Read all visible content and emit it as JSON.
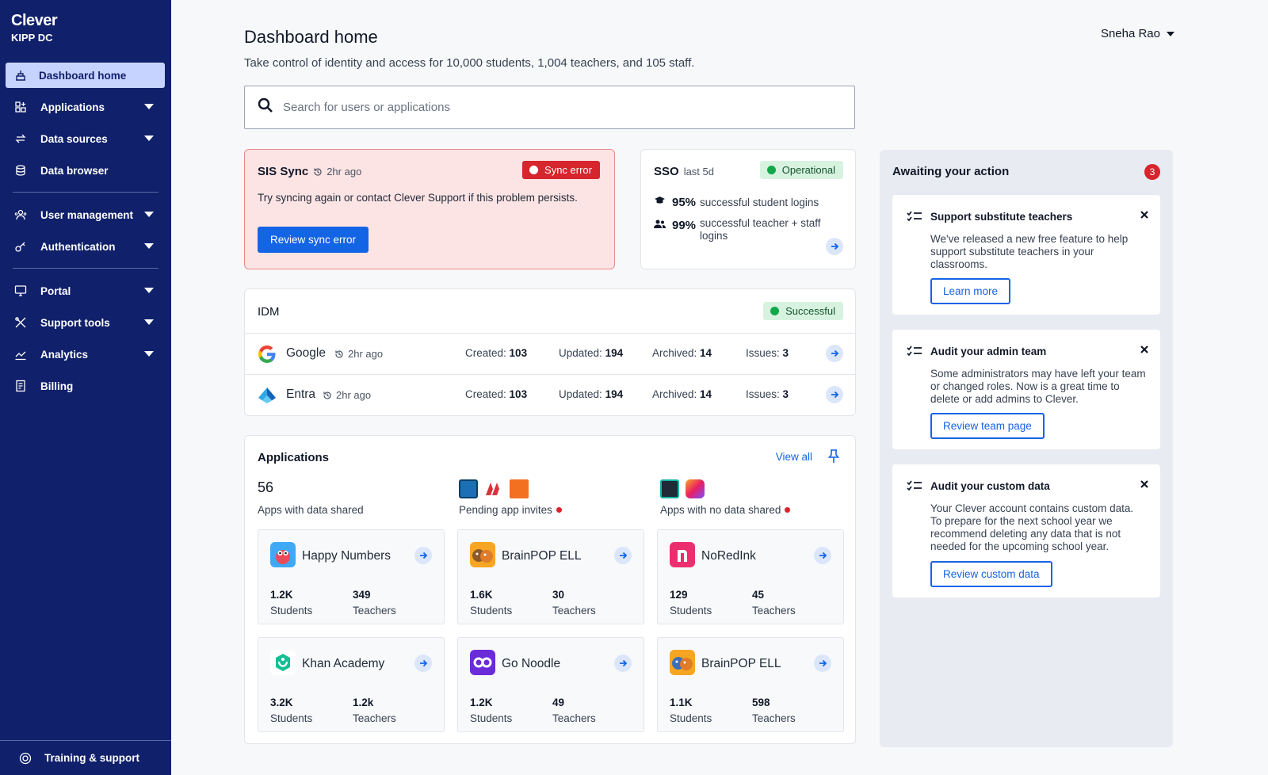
{
  "sidebar": {
    "logo": "Clever",
    "district": "KIPP DC",
    "items": [
      {
        "label": "Dashboard home"
      },
      {
        "label": "Applications"
      },
      {
        "label": "Data sources"
      },
      {
        "label": "Data browser"
      },
      {
        "label": "User management"
      },
      {
        "label": "Authentication"
      },
      {
        "label": "Portal"
      },
      {
        "label": "Support tools"
      },
      {
        "label": "Analytics"
      },
      {
        "label": "Billing"
      }
    ],
    "footer": "Training & support"
  },
  "header": {
    "title": "Dashboard home",
    "subtitle": "Take control of identity and access for 10,000 students, 1,004 teachers, and 105 staff.",
    "user": "Sneha Rao"
  },
  "search": {
    "placeholder": "Search for users or applications"
  },
  "sis": {
    "title": "SIS Sync",
    "time": "2hr ago",
    "badge": "Sync error",
    "message": "Try syncing again or contact Clever Support if this problem persists.",
    "button": "Review sync error"
  },
  "sso": {
    "title": "SSO",
    "period": "last 5d",
    "badge": "Operational",
    "student_pct": "95%",
    "student_label": "successful student logins",
    "teacher_pct": "99%",
    "teacher_label": "successful teacher + staff logins"
  },
  "idm": {
    "title": "IDM",
    "badge": "Successful",
    "rows": [
      {
        "name": "Google",
        "time": "2hr ago",
        "created_label": "Created:",
        "created": "103",
        "updated_label": "Updated:",
        "updated": "194",
        "archived_label": "Archived:",
        "archived": "14",
        "issues_label": "Issues:",
        "issues": "3"
      },
      {
        "name": "Entra",
        "time": "2hr ago",
        "created_label": "Created:",
        "created": "103",
        "updated_label": "Updated:",
        "updated": "194",
        "archived_label": "Archived:",
        "archived": "14",
        "issues_label": "Issues:",
        "issues": "3"
      }
    ]
  },
  "applications": {
    "title": "Applications",
    "view_all": "View all",
    "shared_count": "56",
    "shared_label": "Apps with data shared",
    "pending_label": "Pending app invites",
    "no_data_label": "Apps with no data shared",
    "tiles": [
      {
        "name": "Happy Numbers",
        "students": "1.2K",
        "teachers": "349",
        "students_label": "Students",
        "teachers_label": "Teachers"
      },
      {
        "name": "BrainPOP ELL",
        "students": "1.6K",
        "teachers": "30",
        "students_label": "Students",
        "teachers_label": "Teachers"
      },
      {
        "name": "NoRedInk",
        "students": "129",
        "teachers": "45",
        "students_label": "Students",
        "teachers_label": "Teachers"
      },
      {
        "name": "Khan Academy",
        "students": "3.2K",
        "teachers": "1.2k",
        "students_label": "Students",
        "teachers_label": "Teachers"
      },
      {
        "name": "Go Noodle",
        "students": "1.2K",
        "teachers": "49",
        "students_label": "Students",
        "teachers_label": "Teachers"
      },
      {
        "name": "BrainPOP ELL",
        "students": "1.1K",
        "teachers": "598",
        "students_label": "Students",
        "teachers_label": "Teachers"
      }
    ]
  },
  "actions": {
    "title": "Awaiting your action",
    "count": "3",
    "cards": [
      {
        "title": "Support substitute teachers",
        "desc": "We've released a new free feature to help support substitute teachers in your classrooms.",
        "button": "Learn more"
      },
      {
        "title": "Audit your admin team",
        "desc": "Some administrators may have left your team or changed roles. Now is a great time to delete or add admins to Clever.",
        "button": "Review team page"
      },
      {
        "title": "Audit your custom data",
        "desc": "Your Clever account contains custom data. To prepare for the next school year we recommend deleting any data that is not needed for the upcoming school year.",
        "button": "Review custom data"
      }
    ]
  },
  "colors": {
    "sidebar": "#10206a",
    "accent": "#1464e6",
    "error": "#d6252c",
    "success": "#12a84a"
  }
}
